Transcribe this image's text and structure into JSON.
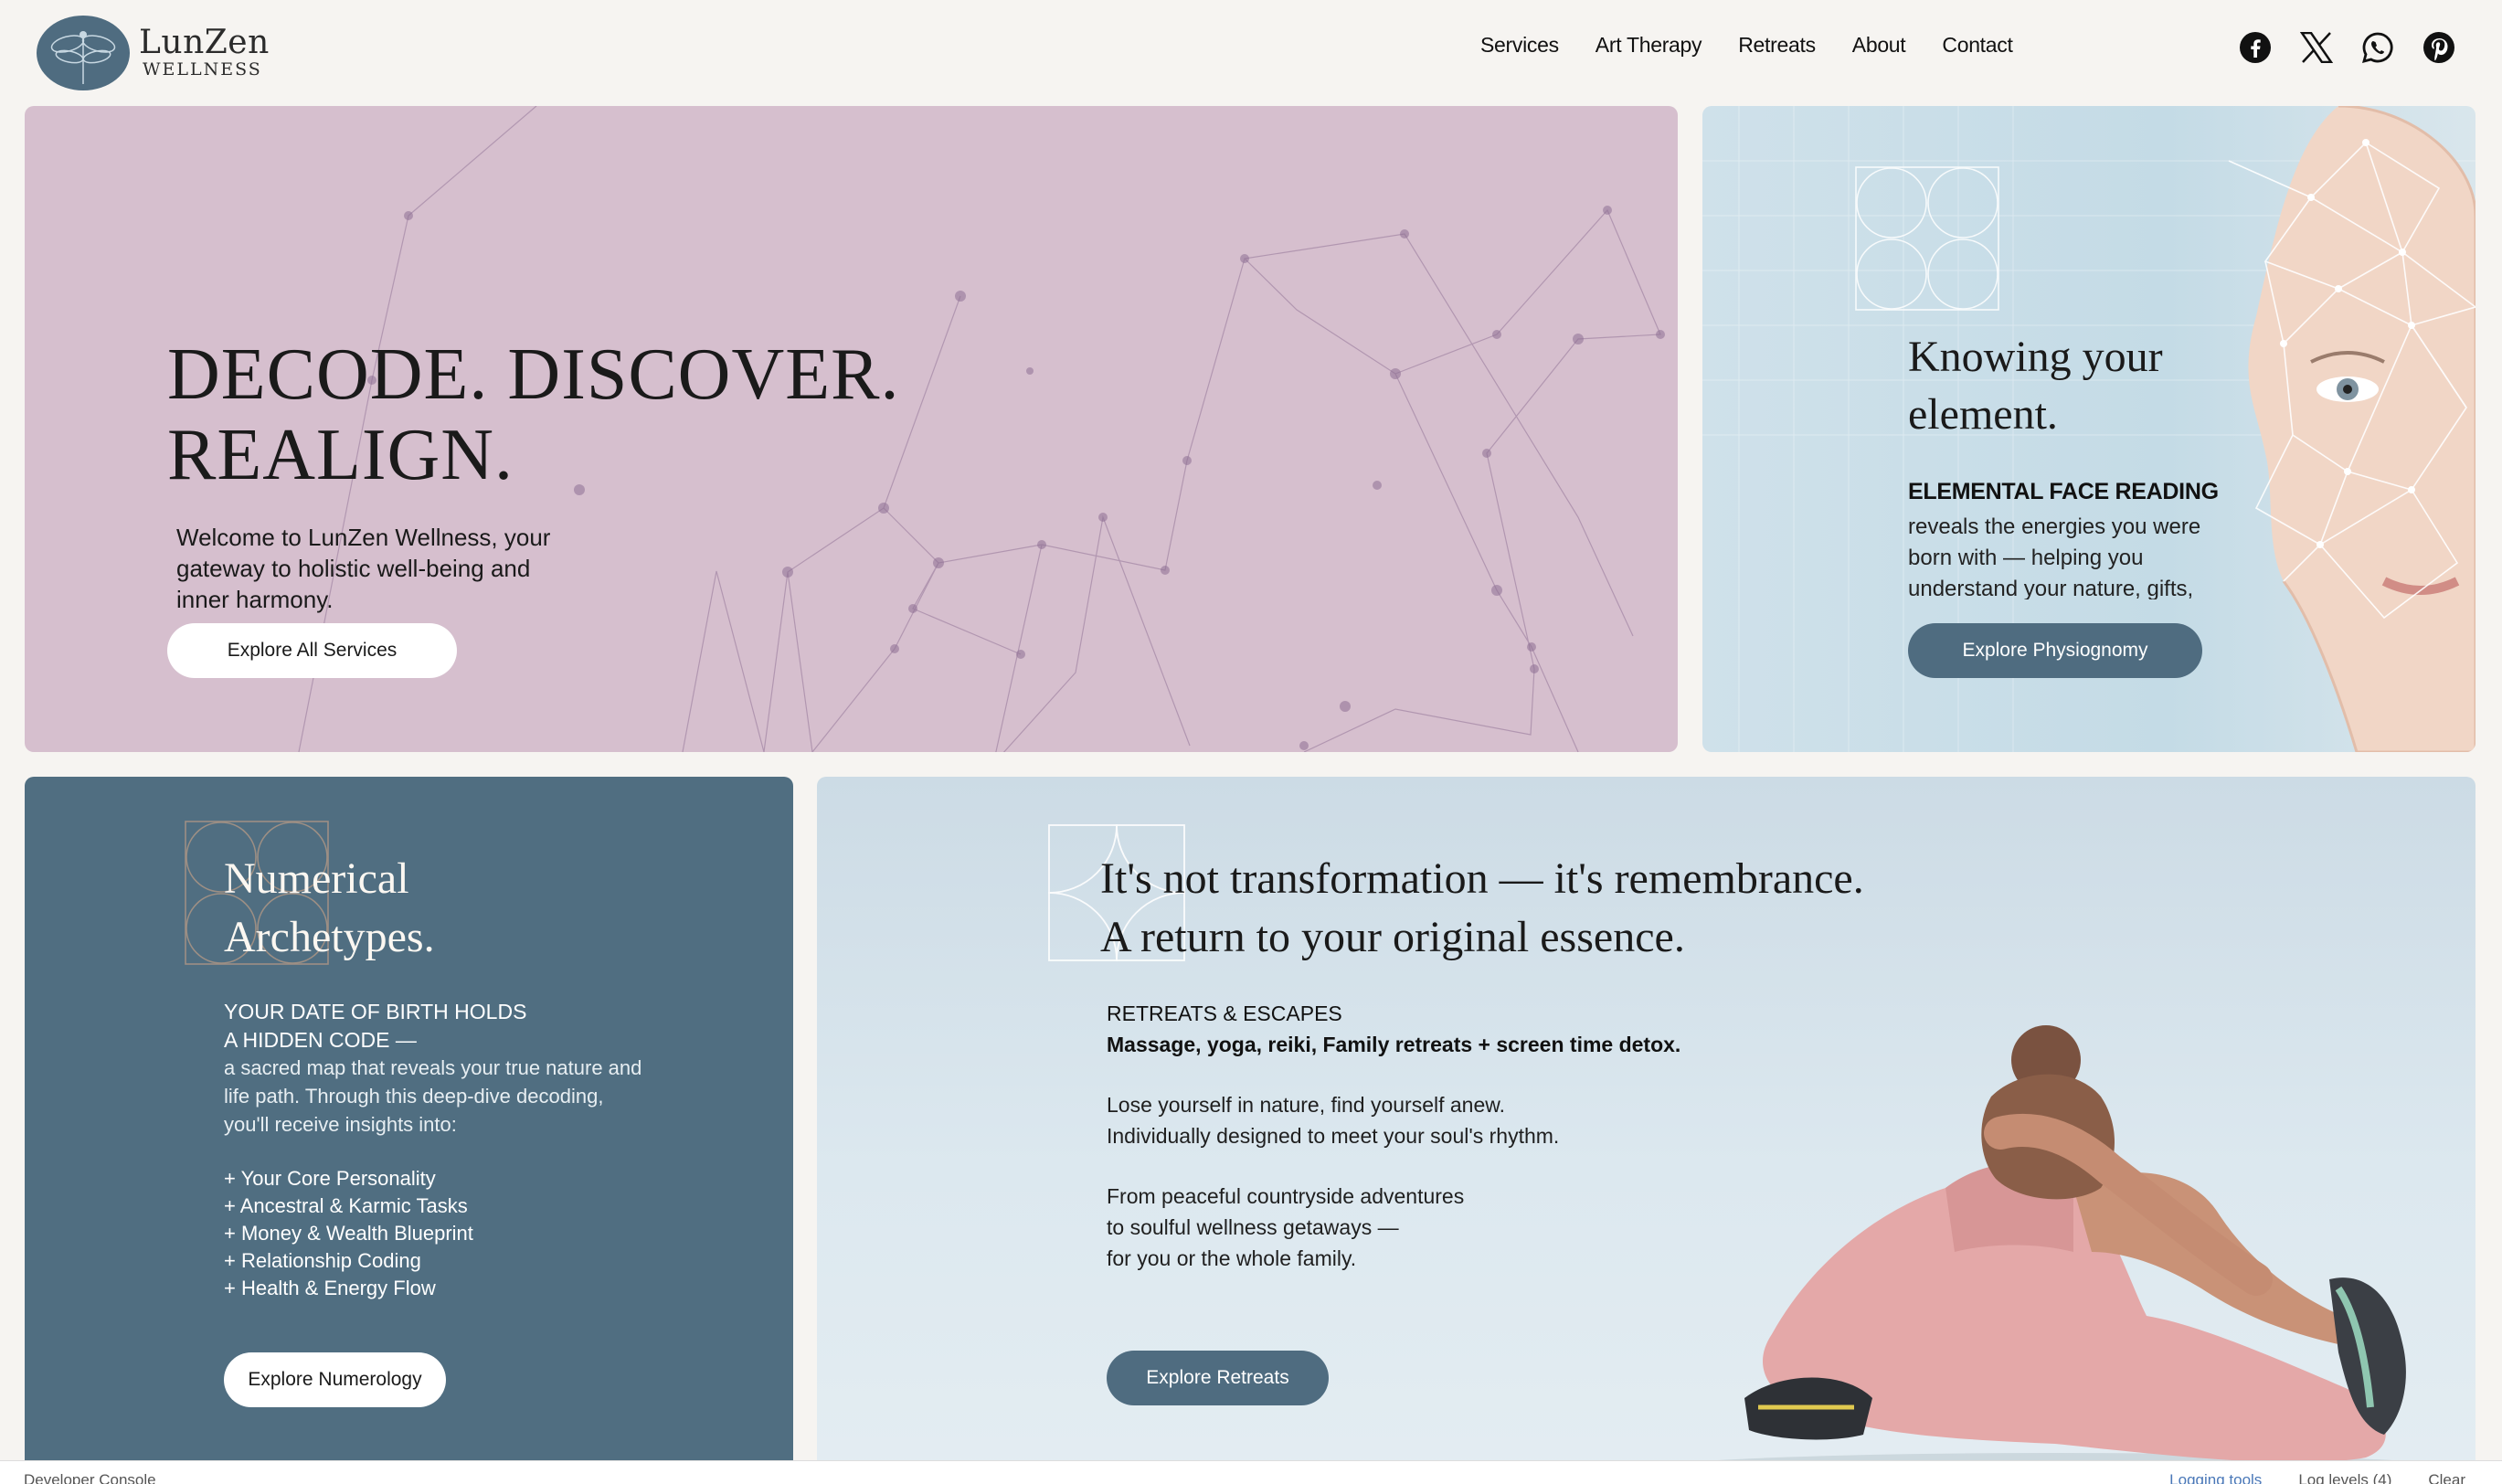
{
  "brand": {
    "name": "LunZen",
    "sub": "WELLNESS"
  },
  "nav": [
    "Services",
    "Art Therapy",
    "Retreats",
    "About",
    "Contact"
  ],
  "socials": [
    "facebook-icon",
    "x-icon",
    "whatsapp-icon",
    "pinterest-icon"
  ],
  "hero": {
    "title_line1": "DECODE. DISCOVER.",
    "title_line2": "REALIGN.",
    "text": "Welcome to LunZen Wellness, your gateway to holistic well-being and inner harmony.",
    "button": "Explore All Services"
  },
  "face": {
    "title_line1": "Knowing your",
    "title_line2": "element.",
    "subtitle": "ELEMENTAL FACE READING",
    "text": "reveals the energies you were born with — helping you understand your nature, gifts, and soul path.",
    "button": "Explore Physiognomy"
  },
  "numerology": {
    "title_line1": "Numerical",
    "title_line2": "Archetypes.",
    "sub_line1": "YOUR DATE OF BIRTH HOLDS",
    "sub_line2": "A HIDDEN CODE —",
    "text": "a sacred map that reveals your true nature and life path. Through this deep-dive decoding, you'll receive insights into:",
    "list": [
      "+ Your Core Personality",
      "+ Ancestral & Karmic Tasks",
      "+ Money & Wealth Blueprint",
      "+ Relationship Coding",
      "+ Health & Energy Flow"
    ],
    "button": "Explore Numerology"
  },
  "retreat": {
    "title_line1": "It's not transformation — it's remembrance.",
    "title_line2": "A return to your original essence.",
    "sub_line1": "RETREATS & ESCAPES",
    "sub_line2": "Massage, yoga, reiki, Family retreats + screen time detox.",
    "p1_line1": "Lose yourself in nature, find yourself anew.",
    "p1_line2": "Individually designed to meet your soul's rhythm.",
    "p2_line1": "From peaceful countryside adventures",
    "p2_line2": "to soulful wellness getaways —",
    "p2_line3": "for you or the whole family.",
    "button": "Explore Retreats"
  },
  "console": {
    "label": "Developer Console",
    "logging": "Logging tools",
    "levels": "Log levels (4)",
    "clear": "Clear"
  },
  "colors": {
    "hero_bg": "#d6bfce",
    "face_bg": "#c4dbe6",
    "numerology_bg": "#506e81",
    "button_blue": "#4f6c80"
  }
}
